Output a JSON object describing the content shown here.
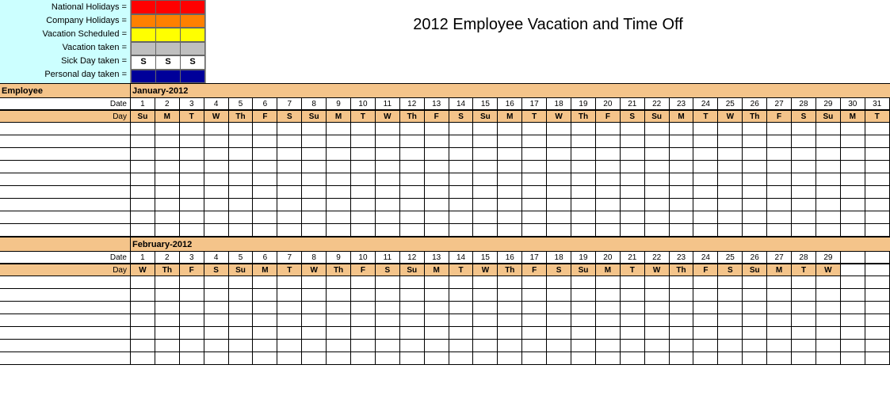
{
  "title": "2012 Employee Vacation and Time Off",
  "legend": {
    "items": [
      {
        "label": "National Holidays =",
        "color": "#ff0000"
      },
      {
        "label": "Company Holidays =",
        "color": "#ff8000"
      },
      {
        "label": "Vacation Scheduled =",
        "color": "#ffff00"
      },
      {
        "label": "Vacation taken =",
        "color": "#bfbfbf"
      },
      {
        "label": "Sick Day taken =",
        "text": "S"
      },
      {
        "label": "Personal day taken =",
        "color": "#000099"
      }
    ]
  },
  "row_labels": {
    "employee": "Employee",
    "date": "Date",
    "day": "Day"
  },
  "months": [
    {
      "name": "January-2012",
      "dates": [
        "1",
        "2",
        "3",
        "4",
        "5",
        "6",
        "7",
        "8",
        "9",
        "10",
        "11",
        "12",
        "13",
        "14",
        "15",
        "16",
        "17",
        "18",
        "19",
        "20",
        "21",
        "22",
        "23",
        "24",
        "25",
        "26",
        "27",
        "28",
        "29",
        "30",
        "31"
      ],
      "days": [
        "Su",
        "M",
        "T",
        "W",
        "Th",
        "F",
        "S",
        "Su",
        "M",
        "T",
        "W",
        "Th",
        "F",
        "S",
        "Su",
        "M",
        "T",
        "W",
        "Th",
        "F",
        "S",
        "Su",
        "M",
        "T",
        "W",
        "Th",
        "F",
        "S",
        "Su",
        "M",
        "T"
      ],
      "blank_rows": 9
    },
    {
      "name": "February-2012",
      "dates": [
        "1",
        "2",
        "3",
        "4",
        "5",
        "6",
        "7",
        "8",
        "9",
        "10",
        "11",
        "12",
        "13",
        "14",
        "15",
        "16",
        "17",
        "18",
        "19",
        "20",
        "21",
        "22",
        "23",
        "24",
        "25",
        "26",
        "27",
        "28",
        "29"
      ],
      "days": [
        "W",
        "Th",
        "F",
        "S",
        "Su",
        "M",
        "T",
        "W",
        "Th",
        "F",
        "S",
        "Su",
        "M",
        "T",
        "W",
        "Th",
        "F",
        "S",
        "Su",
        "M",
        "T",
        "W",
        "Th",
        "F",
        "S",
        "Su",
        "M",
        "T",
        "W"
      ],
      "blank_rows": 7
    }
  ]
}
